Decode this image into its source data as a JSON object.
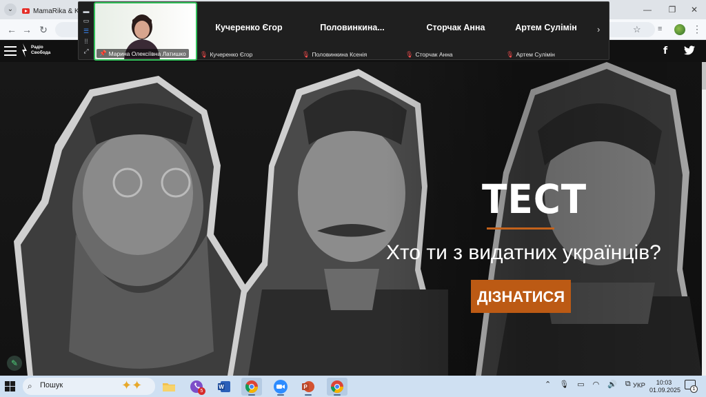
{
  "browser": {
    "tab_title": "MamaRika & KOLA",
    "tab_search_glyph": "⌄",
    "back_glyph": "←",
    "forward_glyph": "→",
    "reload_glyph": "↻",
    "star_glyph": "☆",
    "menu_glyph": "⋮"
  },
  "zoom": {
    "self_name": "Марина Олексіївна Латишко",
    "participants": [
      {
        "display": "Кучеренко Єгор",
        "label": "Кучеренко Єгор"
      },
      {
        "display": "Половинкина...",
        "label": "Половинкина Ксенія"
      },
      {
        "display": "Сторчак Анна",
        "label": "Сторчак Анна"
      },
      {
        "display": "Артем Сулімін",
        "label": "Артем Сулімін"
      }
    ],
    "next_glyph": "›"
  },
  "site": {
    "logo_line1": "Радіо",
    "logo_line2": "Свобода",
    "facebook_glyph": "f"
  },
  "hero": {
    "title": "ТЕСТ",
    "subtitle": "Хто ти з видатних українців?",
    "cta_label": "ДІЗНАТИСЯ"
  },
  "taskbar": {
    "search_placeholder": "Пошук",
    "viber_badge": "5",
    "language": "УКР",
    "time": "10:03",
    "date": "01.09.2025",
    "notifications": "1"
  },
  "colors": {
    "accent_orange": "#bc5a14",
    "zoom_active_border": "#32c05a",
    "hero_bg": "#141414"
  }
}
